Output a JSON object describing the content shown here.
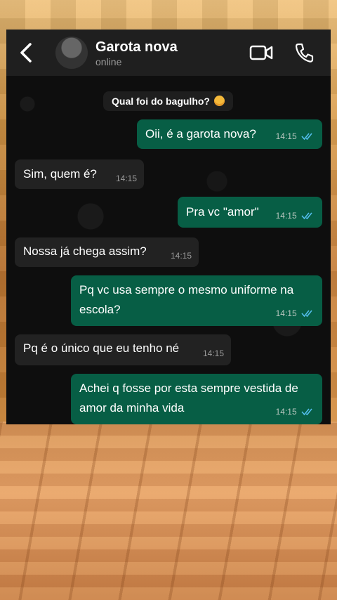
{
  "header": {
    "contact_name": "Garota nova",
    "status": "online",
    "icons": [
      "back-arrow-icon",
      "avatar",
      "video-call-icon",
      "phone-call-icon"
    ]
  },
  "system_banner": {
    "text": "Qual foi do bagulho?",
    "emoji": "flushed-face-emoji"
  },
  "messages": [
    {
      "direction": "out",
      "text": "Oii, é a garota nova?",
      "time": "14:15",
      "read": true
    },
    {
      "direction": "in",
      "text": "Sim, quem é?",
      "time": "14:15"
    },
    {
      "direction": "out",
      "text": "Pra vc \"amor\"",
      "time": "14:15",
      "read": true
    },
    {
      "direction": "in",
      "text": "Nossa já chega assim?",
      "time": "14:15"
    },
    {
      "direction": "out",
      "text": "Pq vc usa sempre o mesmo uniforme na escola?",
      "time": "14:15",
      "read": true
    },
    {
      "direction": "in",
      "text": "Pq é o único que eu tenho né",
      "time": "14:15"
    },
    {
      "direction": "out",
      "text": "Achei q fosse por esta sempre vestida de amor da minha vida",
      "time": "14:15",
      "read": true
    }
  ],
  "colors": {
    "outgoing_bubble": "#075e45",
    "incoming_bubble": "#222222",
    "read_ticks": "#53bdeb"
  }
}
